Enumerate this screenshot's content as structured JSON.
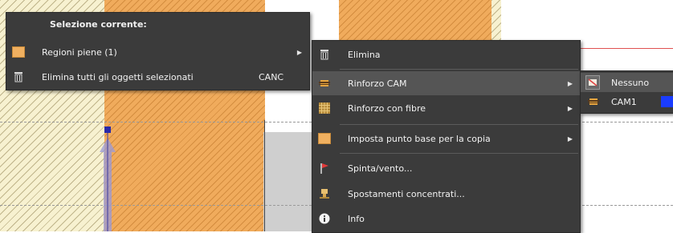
{
  "menu_main": {
    "header": "Selezione corrente:",
    "items": [
      {
        "label": "Regioni piene (1)",
        "has_submenu": true,
        "icon": "filled-region-icon"
      },
      {
        "label": "Elimina tutti gli oggetti selezionati",
        "shortcut": "CANC",
        "icon": "trash-icon"
      }
    ]
  },
  "menu_sub": {
    "items": [
      {
        "label": "Elimina",
        "icon": "trash-icon"
      },
      {
        "label": "Rinforzo CAM",
        "has_submenu": true,
        "icon": "cam-reinforcement-icon"
      },
      {
        "label": "Rinforzo con fibre",
        "has_submenu": true,
        "icon": "fiber-reinforcement-icon"
      },
      {
        "label": "Imposta punto base per la copia",
        "has_submenu": true,
        "icon": "base-point-icon"
      },
      {
        "label": "Spinta/vento...",
        "icon": "red-flag-icon"
      },
      {
        "label": "Spostamenti concentrati...",
        "icon": "displacement-icon"
      },
      {
        "label": "Info",
        "icon": "info-icon"
      }
    ]
  },
  "menu_cam": {
    "items": [
      {
        "label": "Nessuno",
        "icon": "none-icon",
        "checked": true
      },
      {
        "label": "CAM1",
        "icon": "cam-reinforcement-icon",
        "swatch_color": "#1a3cff"
      }
    ]
  },
  "colors": {
    "menu_bg": "#3b3b3b",
    "menu_highlight": "#555555",
    "region_orange": "#f0ab5c",
    "cam1_swatch": "#1a3cff"
  }
}
